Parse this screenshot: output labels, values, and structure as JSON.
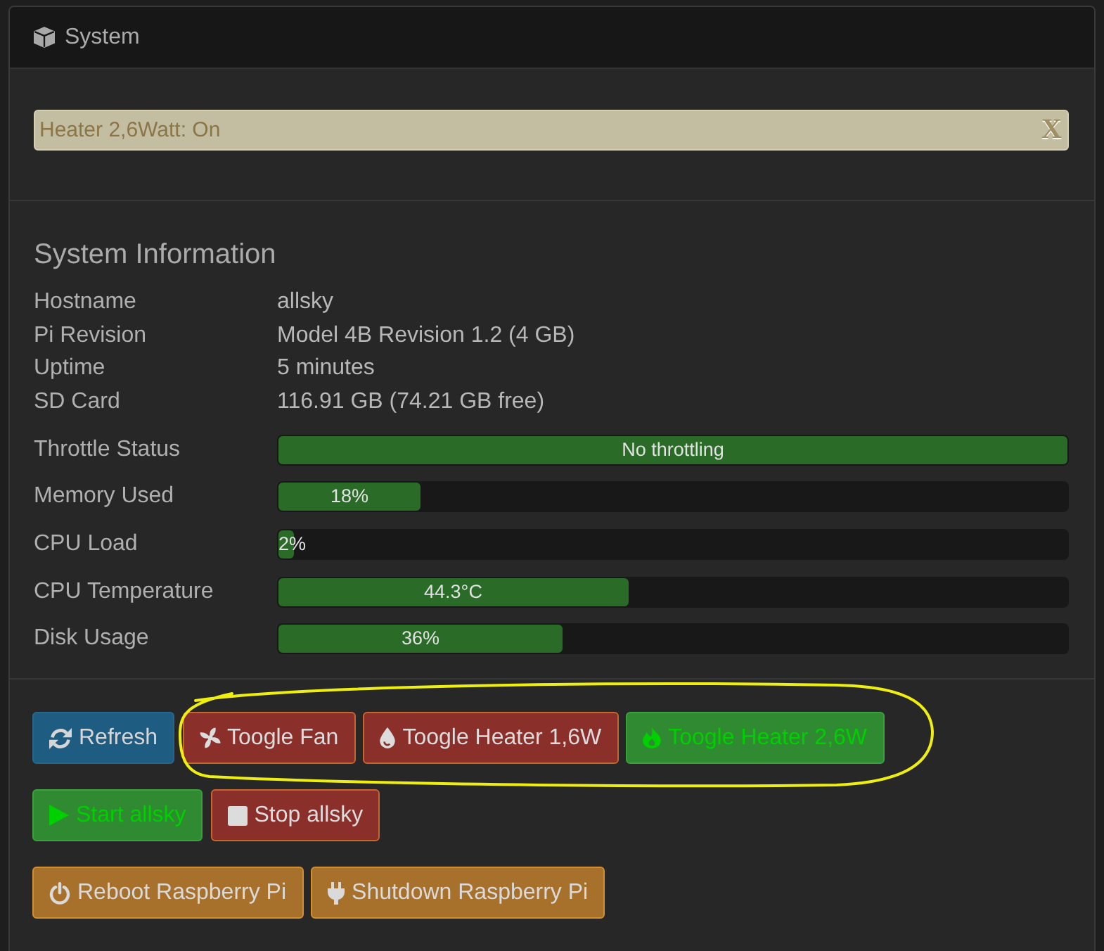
{
  "panel": {
    "title": "System"
  },
  "alert": {
    "text": "Heater 2,6Watt: On",
    "close_label": "X"
  },
  "info": {
    "title": "System Information",
    "rows": [
      {
        "label": "Hostname",
        "value": "allsky"
      },
      {
        "label": "Pi Revision",
        "value": "Model 4B Revision 1.2 (4 GB)"
      },
      {
        "label": "Uptime",
        "value": "5 minutes"
      },
      {
        "label": "SD Card",
        "value": "116.91 GB (74.21 GB free)"
      }
    ],
    "meters": [
      {
        "label": "Throttle Status",
        "level": 1,
        "reading": "No throttling"
      },
      {
        "label": "Memory Used",
        "level": 0.18,
        "reading": "18%"
      },
      {
        "label": "CPU Load",
        "level": 0.02,
        "reading": "2%"
      },
      {
        "label": "CPU Temperature",
        "level": 0.443,
        "reading": "44.3°C"
      },
      {
        "label": "Disk Usage",
        "level": 0.36,
        "reading": "36%"
      }
    ]
  },
  "button_rows": [
    [
      {
        "label": "Refresh",
        "kind": "info"
      },
      {
        "label": "Toogle Fan",
        "kind": "danger"
      },
      {
        "label": "Toogle Heater 1,6W",
        "kind": "danger"
      },
      {
        "label": "Toogle Heater 2,6W",
        "kind": "success"
      }
    ],
    [
      {
        "label": "Start allsky",
        "kind": "success"
      },
      {
        "label": "Stop allsky",
        "kind": "danger"
      }
    ],
    [
      {
        "label": "Reboot Raspberry Pi",
        "kind": "warning"
      },
      {
        "label": "Shutdown Raspberry Pi",
        "kind": "warning"
      }
    ]
  ]
}
